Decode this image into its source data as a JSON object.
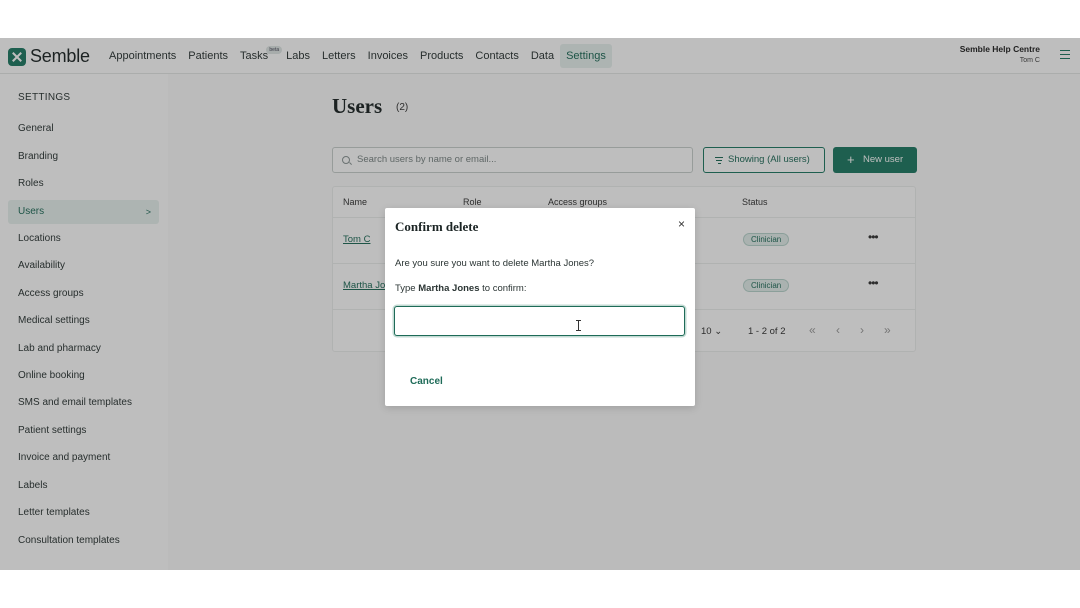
{
  "app": {
    "brand": "Semble"
  },
  "nav": {
    "items": [
      {
        "label": "Appointments"
      },
      {
        "label": "Patients"
      },
      {
        "label": "Tasks",
        "badge": "beta"
      },
      {
        "label": "Labs"
      },
      {
        "label": "Letters"
      },
      {
        "label": "Invoices"
      },
      {
        "label": "Products"
      },
      {
        "label": "Contacts"
      },
      {
        "label": "Data"
      },
      {
        "label": "Settings",
        "active": true
      }
    ],
    "help": "Semble Help Centre",
    "user": "Tom C",
    "menu_icon": "hamburger-menu-icon"
  },
  "sidebar": {
    "title": "SETTINGS",
    "items": [
      {
        "label": "General"
      },
      {
        "label": "Branding"
      },
      {
        "label": "Roles"
      },
      {
        "label": "Users",
        "active": true,
        "chevron": ">"
      },
      {
        "label": "Locations"
      },
      {
        "label": "Availability"
      },
      {
        "label": "Access groups"
      },
      {
        "label": "Medical settings"
      },
      {
        "label": "Lab and pharmacy"
      },
      {
        "label": "Online booking"
      },
      {
        "label": "SMS and email templates"
      },
      {
        "label": "Patient settings"
      },
      {
        "label": "Invoice and payment"
      },
      {
        "label": "Labels"
      },
      {
        "label": "Letter templates"
      },
      {
        "label": "Consultation templates"
      }
    ]
  },
  "main": {
    "title": "Users",
    "count": "(2)",
    "search_placeholder": "Search users by name or email...",
    "filter_label": "Showing (All users)",
    "new_user_label": "New user",
    "table": {
      "headers": [
        "Name",
        "Role",
        "Access groups",
        "Status"
      ],
      "rows": [
        {
          "name": "Tom C",
          "status": "Clinician",
          "actions": "•••"
        },
        {
          "name": "Martha Jones",
          "status": "Clinician",
          "actions": "•••"
        }
      ],
      "page_size": "10",
      "range": "1 - 2 of 2",
      "pager": {
        "first": "«",
        "prev": "‹",
        "next": "›",
        "last": "»"
      }
    }
  },
  "modal": {
    "title": "Confirm delete",
    "close": "×",
    "question": "Are you sure you want to delete Martha Jones?",
    "type_prefix": "Type",
    "type_name": "Martha Jones",
    "type_suffix": "to confirm:",
    "input_value": "",
    "cancel_label": "Cancel"
  }
}
